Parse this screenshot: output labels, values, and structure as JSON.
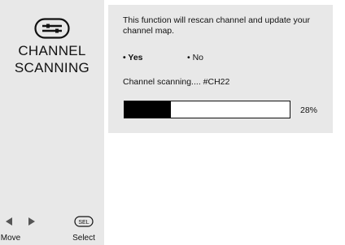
{
  "sidebar": {
    "icon": "tools-icon",
    "title_line1": "CHANNEL",
    "title_line2": "SCANNING",
    "hints": {
      "move_label": "Move",
      "select_label": "Select",
      "select_key": "SEL",
      "move_icon": "left-right-arrows-icon"
    }
  },
  "panel": {
    "description": "This function will rescan channel and update your channel map.",
    "options": {
      "yes": "• Yes",
      "no": "• No",
      "selected": "yes"
    },
    "status_text": "Channel scanning.... #CH22",
    "progress": {
      "value": 0.28,
      "label": "28%"
    }
  },
  "colors": {
    "panel_bg": "#e8e8e8",
    "progress_fill": "#000000"
  }
}
